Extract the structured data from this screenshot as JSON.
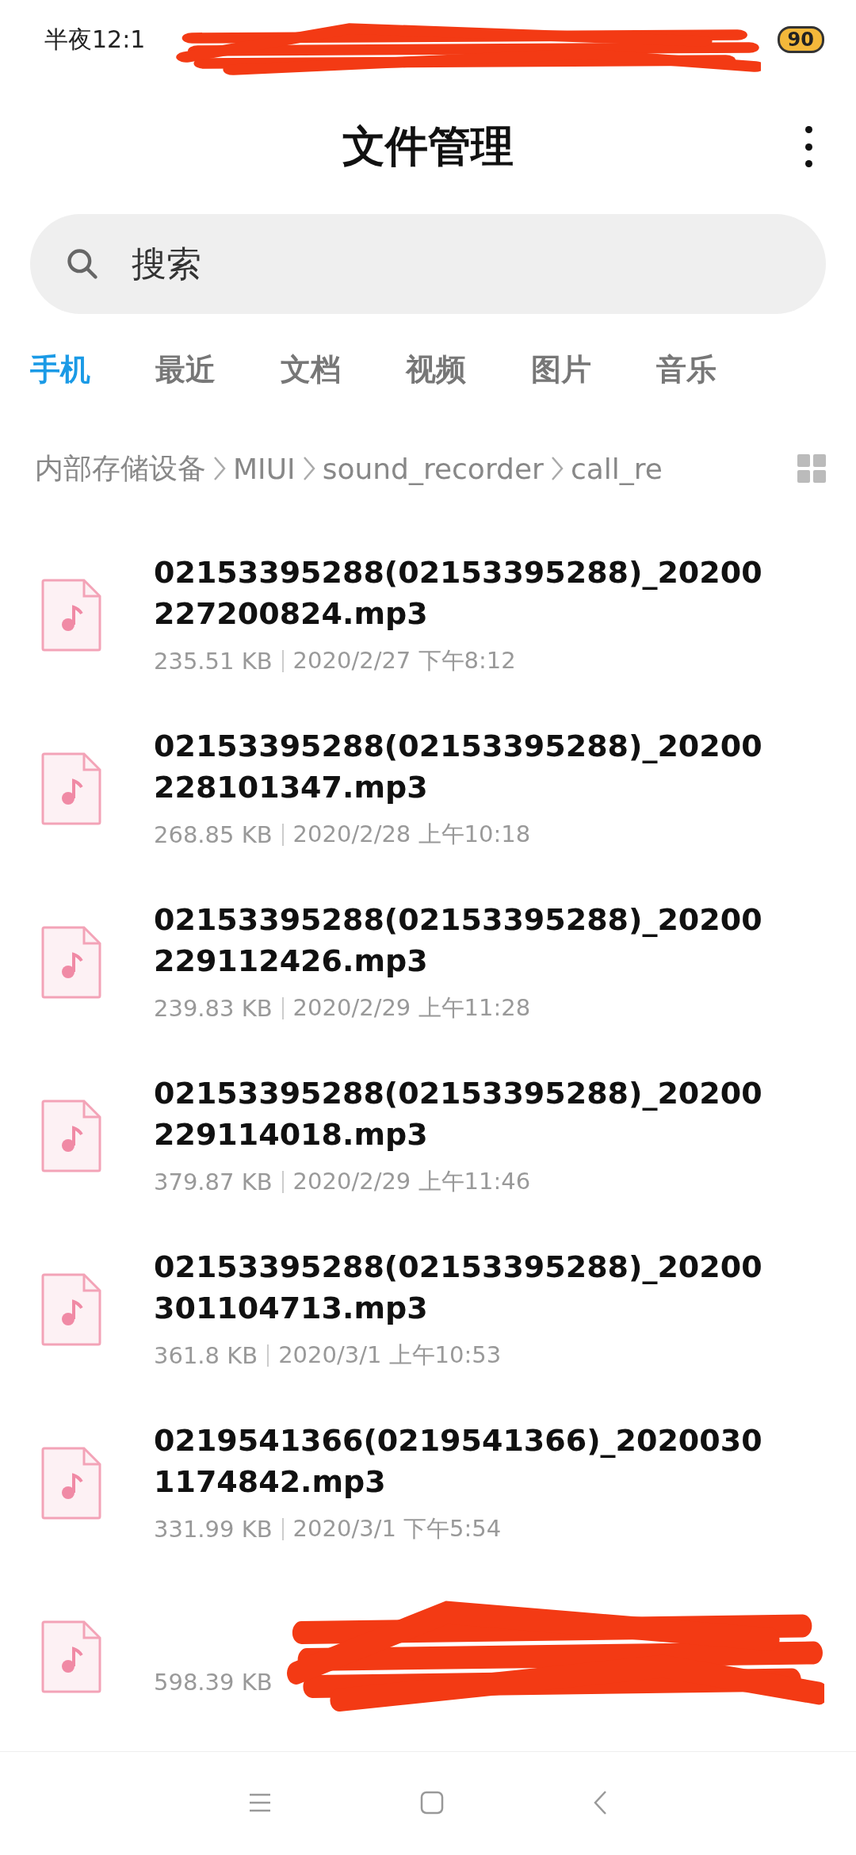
{
  "status_bar": {
    "time": "半夜12:1",
    "battery": "90"
  },
  "header": {
    "title": "文件管理"
  },
  "search": {
    "placeholder": "搜索"
  },
  "tabs": [
    {
      "label": "手机",
      "selected": true
    },
    {
      "label": "最近",
      "selected": false
    },
    {
      "label": "文档",
      "selected": false
    },
    {
      "label": "视频",
      "selected": false
    },
    {
      "label": "图片",
      "selected": false
    },
    {
      "label": "音乐",
      "selected": false
    }
  ],
  "breadcrumb": [
    "内部存储设备",
    "MIUI",
    "sound_recorder",
    "call_re"
  ],
  "files": [
    {
      "name": "02153395288(02153395288)_20200227200824.mp3",
      "size": "235.51 KB",
      "date": "2020/2/27 下午8:12"
    },
    {
      "name": "02153395288(02153395288)_20200228101347.mp3",
      "size": "268.85 KB",
      "date": "2020/2/28 上午10:18"
    },
    {
      "name": "02153395288(02153395288)_20200229112426.mp3",
      "size": "239.83 KB",
      "date": "2020/2/29 上午11:28"
    },
    {
      "name": "02153395288(02153395288)_20200229114018.mp3",
      "size": "379.87 KB",
      "date": "2020/2/29 上午11:46"
    },
    {
      "name": "02153395288(02153395288)_20200301104713.mp3",
      "size": "361.8 KB",
      "date": "2020/3/1 上午10:53"
    },
    {
      "name": "0219541366(0219541366)_20200301174842.mp3",
      "size": "331.99 KB",
      "date": "2020/3/1 下午5:54"
    },
    {
      "size": "598.39 KB",
      "redacted": true
    }
  ]
}
